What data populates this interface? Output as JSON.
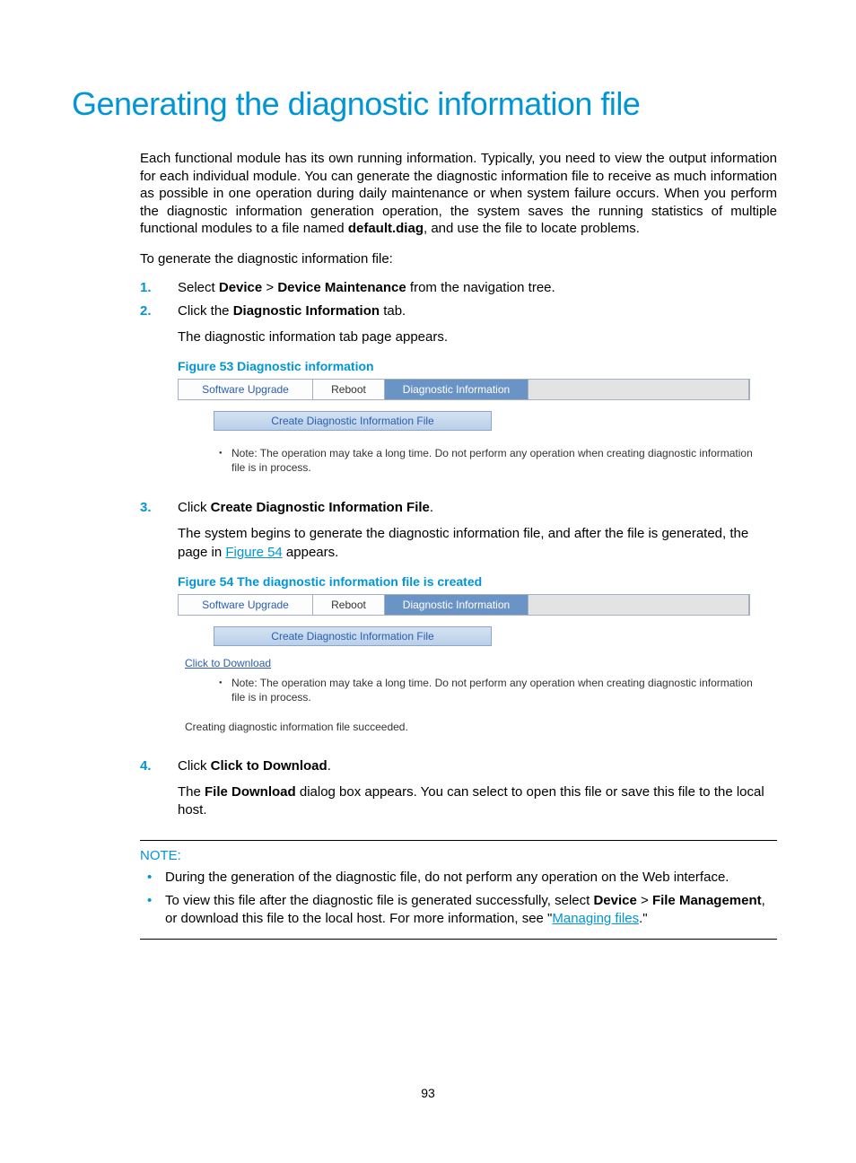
{
  "title": "Generating the diagnostic information file",
  "intro": {
    "p1a": "Each functional module has its own running information. Typically, you need to view the output information for each individual module. You can generate the diagnostic information file to receive as much information as possible in one operation during daily maintenance or when system failure occurs. When you perform the diagnostic information generation operation, the system saves the running statistics of multiple functional modules to a file named ",
    "p1b": "default.diag",
    "p1c": ", and use the file to locate problems.",
    "p2": "To generate the diagnostic information file:"
  },
  "steps": {
    "s1": {
      "num": "1.",
      "a": "Select ",
      "b": "Device",
      "c": " > ",
      "d": "Device Maintenance",
      "e": " from the navigation tree."
    },
    "s2": {
      "num": "2.",
      "a": "Click the ",
      "b": "Diagnostic Information",
      "c": " tab.",
      "sub": "The diagnostic information tab page appears."
    },
    "s3": {
      "num": "3.",
      "a": "Click ",
      "b": "Create Diagnostic Information File",
      "c": ".",
      "sub_a": "The system begins to generate the diagnostic information file, and after the file is generated, the page in ",
      "sub_link": "Figure 54",
      "sub_b": " appears."
    },
    "s4": {
      "num": "4.",
      "a": "Click ",
      "b": "Click to Download",
      "c": ".",
      "sub_a": "The ",
      "sub_b": "File Download",
      "sub_c": " dialog box appears. You can select to open this file or save this file to the local host."
    }
  },
  "figures": {
    "f53": "Figure 53 Diagnostic information",
    "f54": "Figure 54 The diagnostic information file is created"
  },
  "ui": {
    "tab_software": "Software Upgrade",
    "tab_reboot": "Reboot",
    "tab_diag": "Diagnostic Information",
    "create_btn": "Create Diagnostic Information File",
    "note": "Note: The operation may take a long time. Do not perform any operation when creating diagnostic information file is in process.",
    "download": "Click to Download",
    "status": "Creating diagnostic information file succeeded."
  },
  "notebox": {
    "label": "NOTE:",
    "n1": "During the generation of the diagnostic file, do not perform any operation on the Web interface.",
    "n2a": "To view this file after the diagnostic file is generated successfully, select ",
    "n2b": "Device",
    "n2c": " > ",
    "n2d": "File Management",
    "n2e": ", or download this file to the local host. For more information, see \"",
    "n2link": "Managing files",
    "n2f": ".\""
  },
  "pagenum": "93"
}
